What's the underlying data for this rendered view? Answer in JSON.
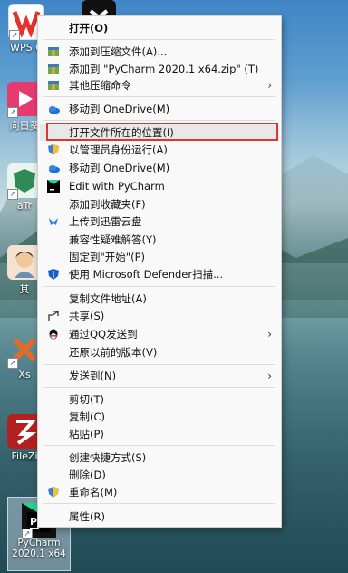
{
  "desktop": {
    "icons": [
      {
        "label": "WPS C",
        "color": "#e5322d"
      },
      {
        "label": "向日葵",
        "color": "#e63b6f"
      },
      {
        "label": "aTr",
        "color": "#2e8b57"
      },
      {
        "label": "其",
        "color": "#f0c8a0"
      },
      {
        "label": "Xs",
        "color": "#e36b2a"
      },
      {
        "label": "FileZi",
        "color": "#b3201f"
      },
      {
        "label": "PyCharm 2020.1 x64",
        "color": "#1a1a1a"
      }
    ],
    "top_icon2_color": "#111111"
  },
  "menu": {
    "items": [
      {
        "label": "打开(O)",
        "icon": "none",
        "bold": true
      },
      {
        "label": "添加到压缩文件(A)...",
        "icon": "archive-icon"
      },
      {
        "label": "添加到 \"PyCharm 2020.1 x64.zip\" (T)",
        "icon": "archive-icon"
      },
      {
        "label": "其他压缩命令",
        "icon": "archive-icon",
        "submenu": true
      },
      {
        "label": "移动到 OneDrive(M)",
        "icon": "onedrive-icon"
      },
      {
        "label": "打开文件所在的位置(I)",
        "icon": "none"
      },
      {
        "label": "以管理员身份运行(A)",
        "icon": "shield-uac-icon"
      },
      {
        "label": "移动到 OneDrive(M)",
        "icon": "onedrive-icon"
      },
      {
        "label": "Edit with PyCharm",
        "icon": "pycharm-icon"
      },
      {
        "label": "添加到收藏夹(F)",
        "icon": "none"
      },
      {
        "label": "上传到迅雷云盘",
        "icon": "xunlei-icon"
      },
      {
        "label": "兼容性疑难解答(Y)",
        "icon": "none"
      },
      {
        "label": "固定到\"开始\"(P)",
        "icon": "none"
      },
      {
        "label": "使用 Microsoft Defender扫描...",
        "icon": "defender-icon"
      },
      {
        "label": "复制文件地址(A)",
        "icon": "none"
      },
      {
        "label": "共享(S)",
        "icon": "share-icon"
      },
      {
        "label": "通过QQ发送到",
        "icon": "qq-icon",
        "submenu": true
      },
      {
        "label": "还原以前的版本(V)",
        "icon": "none"
      },
      {
        "label": "发送到(N)",
        "icon": "none",
        "submenu": true
      },
      {
        "label": "剪切(T)",
        "icon": "none"
      },
      {
        "label": "复制(C)",
        "icon": "none"
      },
      {
        "label": "粘贴(P)",
        "icon": "none"
      },
      {
        "label": "创建快捷方式(S)",
        "icon": "none"
      },
      {
        "label": "删除(D)",
        "icon": "none"
      },
      {
        "label": "重命名(M)",
        "icon": "shield-uac-icon"
      },
      {
        "label": "属性(R)",
        "icon": "none"
      }
    ],
    "submenu_arrow": "›",
    "highlight_color": "#d93636"
  }
}
